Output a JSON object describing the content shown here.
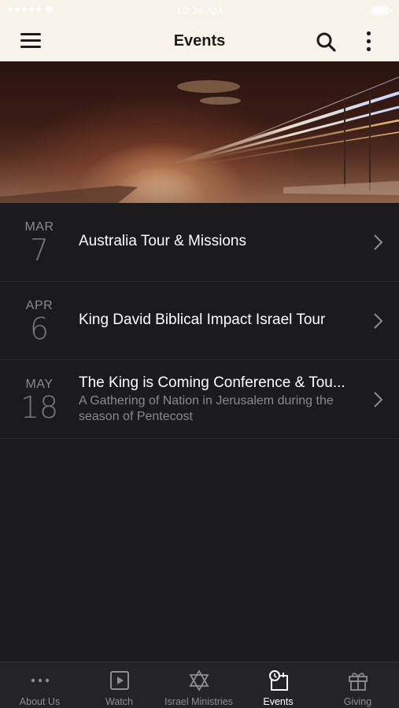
{
  "status_bar": {
    "time": "10:36 AM"
  },
  "header": {
    "title": "Events"
  },
  "events": [
    {
      "month": "MAR",
      "day": "7",
      "title": "Australia Tour & Missions",
      "subtitle": ""
    },
    {
      "month": "APR",
      "day": "6",
      "title": "King David Biblical Impact Israel Tour",
      "subtitle": ""
    },
    {
      "month": "MAY",
      "day": "18",
      "title": "The King is Coming Conference & Tou...",
      "subtitle": "A Gathering of Nation in Jerusalem during the season of Pentecost"
    }
  ],
  "tabs": [
    {
      "label": "About Us",
      "icon": "more-dots-icon",
      "active": false
    },
    {
      "label": "Watch",
      "icon": "play-icon",
      "active": false
    },
    {
      "label": "Israel Ministries",
      "icon": "star-of-david-icon",
      "active": false
    },
    {
      "label": "Events",
      "icon": "calendar-clock-icon",
      "active": true
    },
    {
      "label": "Giving",
      "icon": "gift-icon",
      "active": false
    }
  ],
  "colors": {
    "header_bg": "#f7f2ea",
    "content_bg": "#1b1b1d",
    "tab_bar_bg": "#242426",
    "active_tab": "#ffffff",
    "inactive_tab": "#8e8e92"
  }
}
